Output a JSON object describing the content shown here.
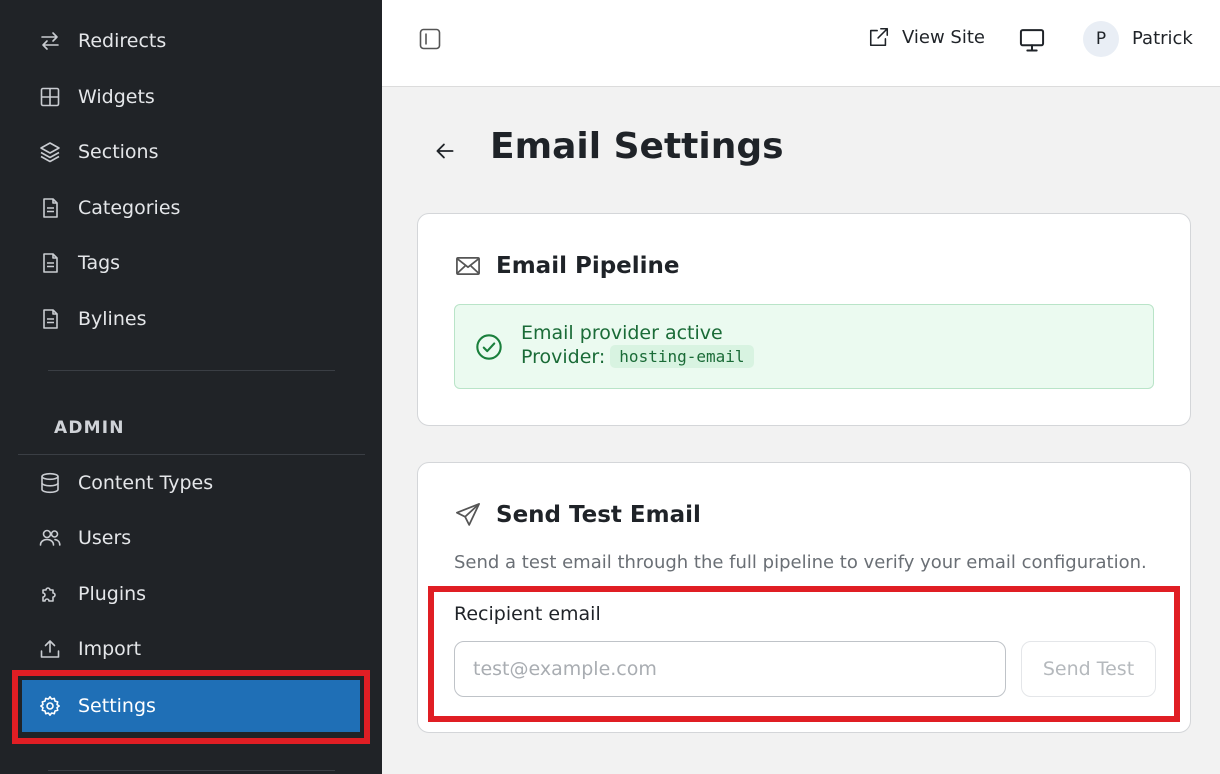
{
  "sidebar": {
    "items": [
      {
        "label": "Redirects",
        "icon": "redirects-arrows-icon"
      },
      {
        "label": "Widgets",
        "icon": "widgets-grid-icon"
      },
      {
        "label": "Sections",
        "icon": "layers-icon"
      },
      {
        "label": "Categories",
        "icon": "document-icon"
      },
      {
        "label": "Tags",
        "icon": "document-icon"
      },
      {
        "label": "Bylines",
        "icon": "document-icon"
      }
    ],
    "admin_label": "ADMIN",
    "admin_items": [
      {
        "label": "Content Types",
        "icon": "database-icon"
      },
      {
        "label": "Users",
        "icon": "users-icon"
      },
      {
        "label": "Plugins",
        "icon": "puzzle-icon"
      },
      {
        "label": "Import",
        "icon": "upload-icon"
      },
      {
        "label": "Settings",
        "icon": "gear-icon",
        "active": true
      }
    ]
  },
  "topbar": {
    "view_site": "View Site",
    "avatar_initial": "P",
    "user_name": "Patrick"
  },
  "page": {
    "title": "Email Settings"
  },
  "pipeline_card": {
    "title": "Email Pipeline",
    "status_title": "Email provider active",
    "provider_label": "Provider:",
    "provider_value": "hosting-email"
  },
  "test_card": {
    "title": "Send Test Email",
    "description": "Send a test email through the full pipeline to verify your email configuration.",
    "recipient_label": "Recipient email",
    "recipient_placeholder": "test@example.com",
    "recipient_value": "",
    "send_label": "Send Test"
  },
  "colors": {
    "sidebar_bg": "#202327",
    "active_item": "#1f6fb6",
    "highlight": "#e01e24",
    "success_bg": "#ebfaf0",
    "success_text": "#1a6b37"
  }
}
